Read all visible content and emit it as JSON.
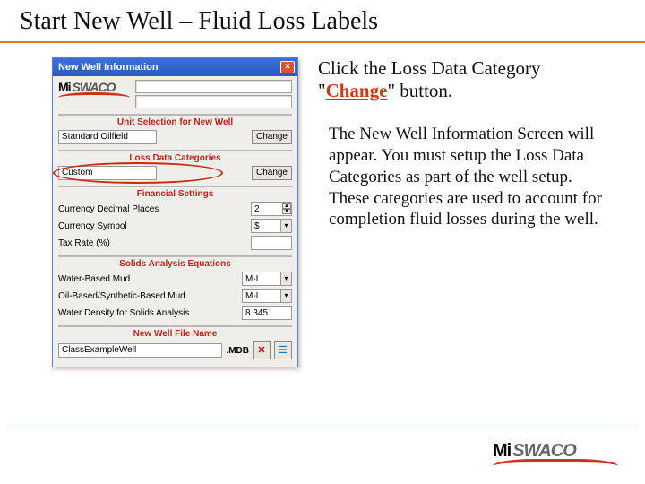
{
  "slide": {
    "title": "Start New Well – Fluid Loss Labels"
  },
  "dialog": {
    "title": "New Well Information",
    "sections": {
      "unit": {
        "heading": "Unit Selection for New Well",
        "value": "Standard Oilfield",
        "change": "Change"
      },
      "lossdata": {
        "heading": "Loss Data Categories",
        "value": "Custom",
        "change": "Change"
      },
      "financial": {
        "heading": "Financial Settings",
        "decimal_label": "Currency Decimal Places",
        "decimal_value": "2",
        "symbol_label": "Currency Symbol",
        "symbol_value": "$",
        "tax_label": "Tax Rate (%)",
        "tax_value": ""
      },
      "solids": {
        "heading": "Solids Analysis Equations",
        "wbm_label": "Water-Based Mud",
        "wbm_value": "M-I",
        "obm_label": "Oil-Based/Synthetic-Based Mud",
        "obm_value": "M-I",
        "wdensity_label": "Water Density for Solids Analysis",
        "wdensity_value": "8.345"
      },
      "filename": {
        "heading": "New Well File Name",
        "value": "ClassExampleWell",
        "ext": ".MDB"
      }
    }
  },
  "right": {
    "line1_pre": "Click the Loss Data Category \"",
    "line1_hl": "Change",
    "line1_post": "\" button.",
    "para": "The New Well Information Screen will appear. You must setup the Loss Data Categories as part of the well setup. These categories are used to account for completion fluid losses during the well."
  },
  "brand": {
    "mi": "Mi",
    "swaco": "SWACO"
  }
}
